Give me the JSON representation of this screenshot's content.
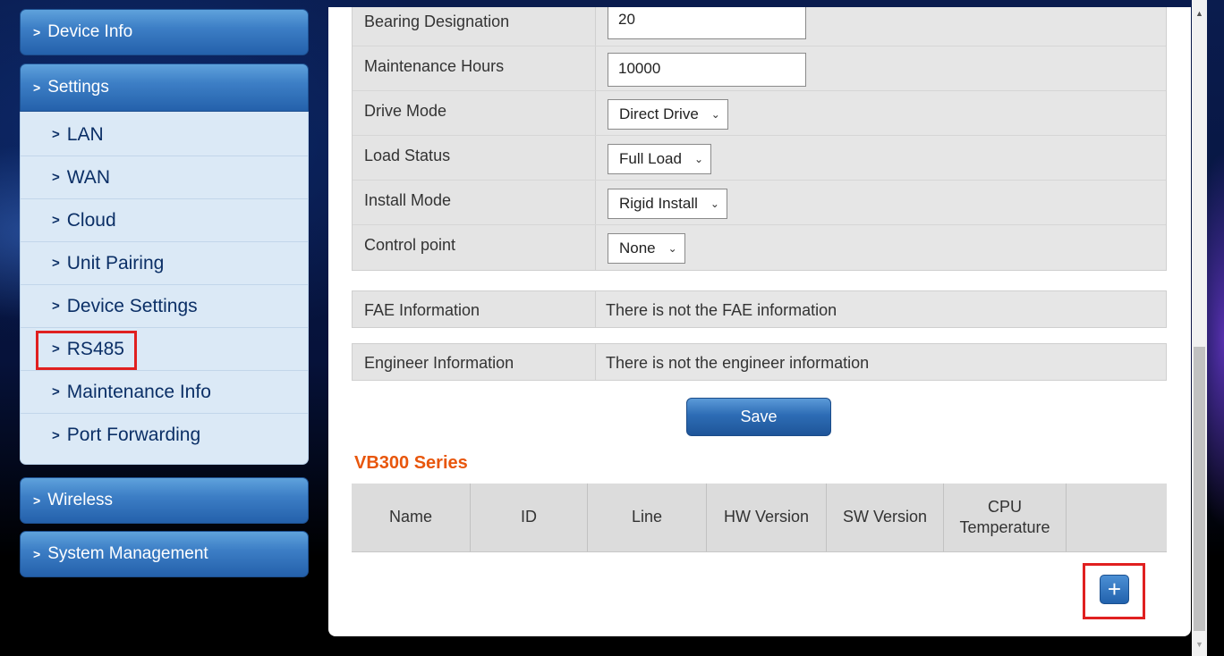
{
  "sidebar": {
    "device_info": "Device Info",
    "settings": "Settings",
    "settings_items": [
      {
        "label": "LAN"
      },
      {
        "label": "WAN"
      },
      {
        "label": "Cloud"
      },
      {
        "label": "Unit Pairing"
      },
      {
        "label": "Device Settings"
      },
      {
        "label": "RS485"
      },
      {
        "label": "Maintenance Info"
      },
      {
        "label": "Port Forwarding"
      }
    ],
    "wireless": "Wireless",
    "system_management": "System Management",
    "chevron": ">"
  },
  "form": {
    "bearing_designation": {
      "label": "Bearing Designation",
      "value": "20"
    },
    "maintenance_hours": {
      "label": "Maintenance Hours",
      "value": "10000"
    },
    "drive_mode": {
      "label": "Drive Mode",
      "value": "Direct Drive"
    },
    "load_status": {
      "label": "Load Status",
      "value": "Full Load"
    },
    "install_mode": {
      "label": "Install Mode",
      "value": "Rigid Install"
    },
    "control_point": {
      "label": "Control point",
      "value": "None"
    }
  },
  "fae": {
    "label": "FAE Information",
    "value": "There is not the FAE information"
  },
  "engineer": {
    "label": "Engineer Information",
    "value": "There is not the engineer information"
  },
  "save_label": "Save",
  "vb300": {
    "title": "VB300 Series",
    "columns": [
      "Name",
      "ID",
      "Line",
      "HW Version",
      "SW Version",
      "CPU Temperature",
      ""
    ],
    "add_label": "+"
  },
  "colors": {
    "section_title": "#e8560c",
    "highlight_box": "#e02020",
    "nav_blue": "#3d7fc6"
  },
  "icons": {
    "chevron": "chevron-right-icon",
    "caret": "chevron-down-icon",
    "add": "plus-icon"
  }
}
